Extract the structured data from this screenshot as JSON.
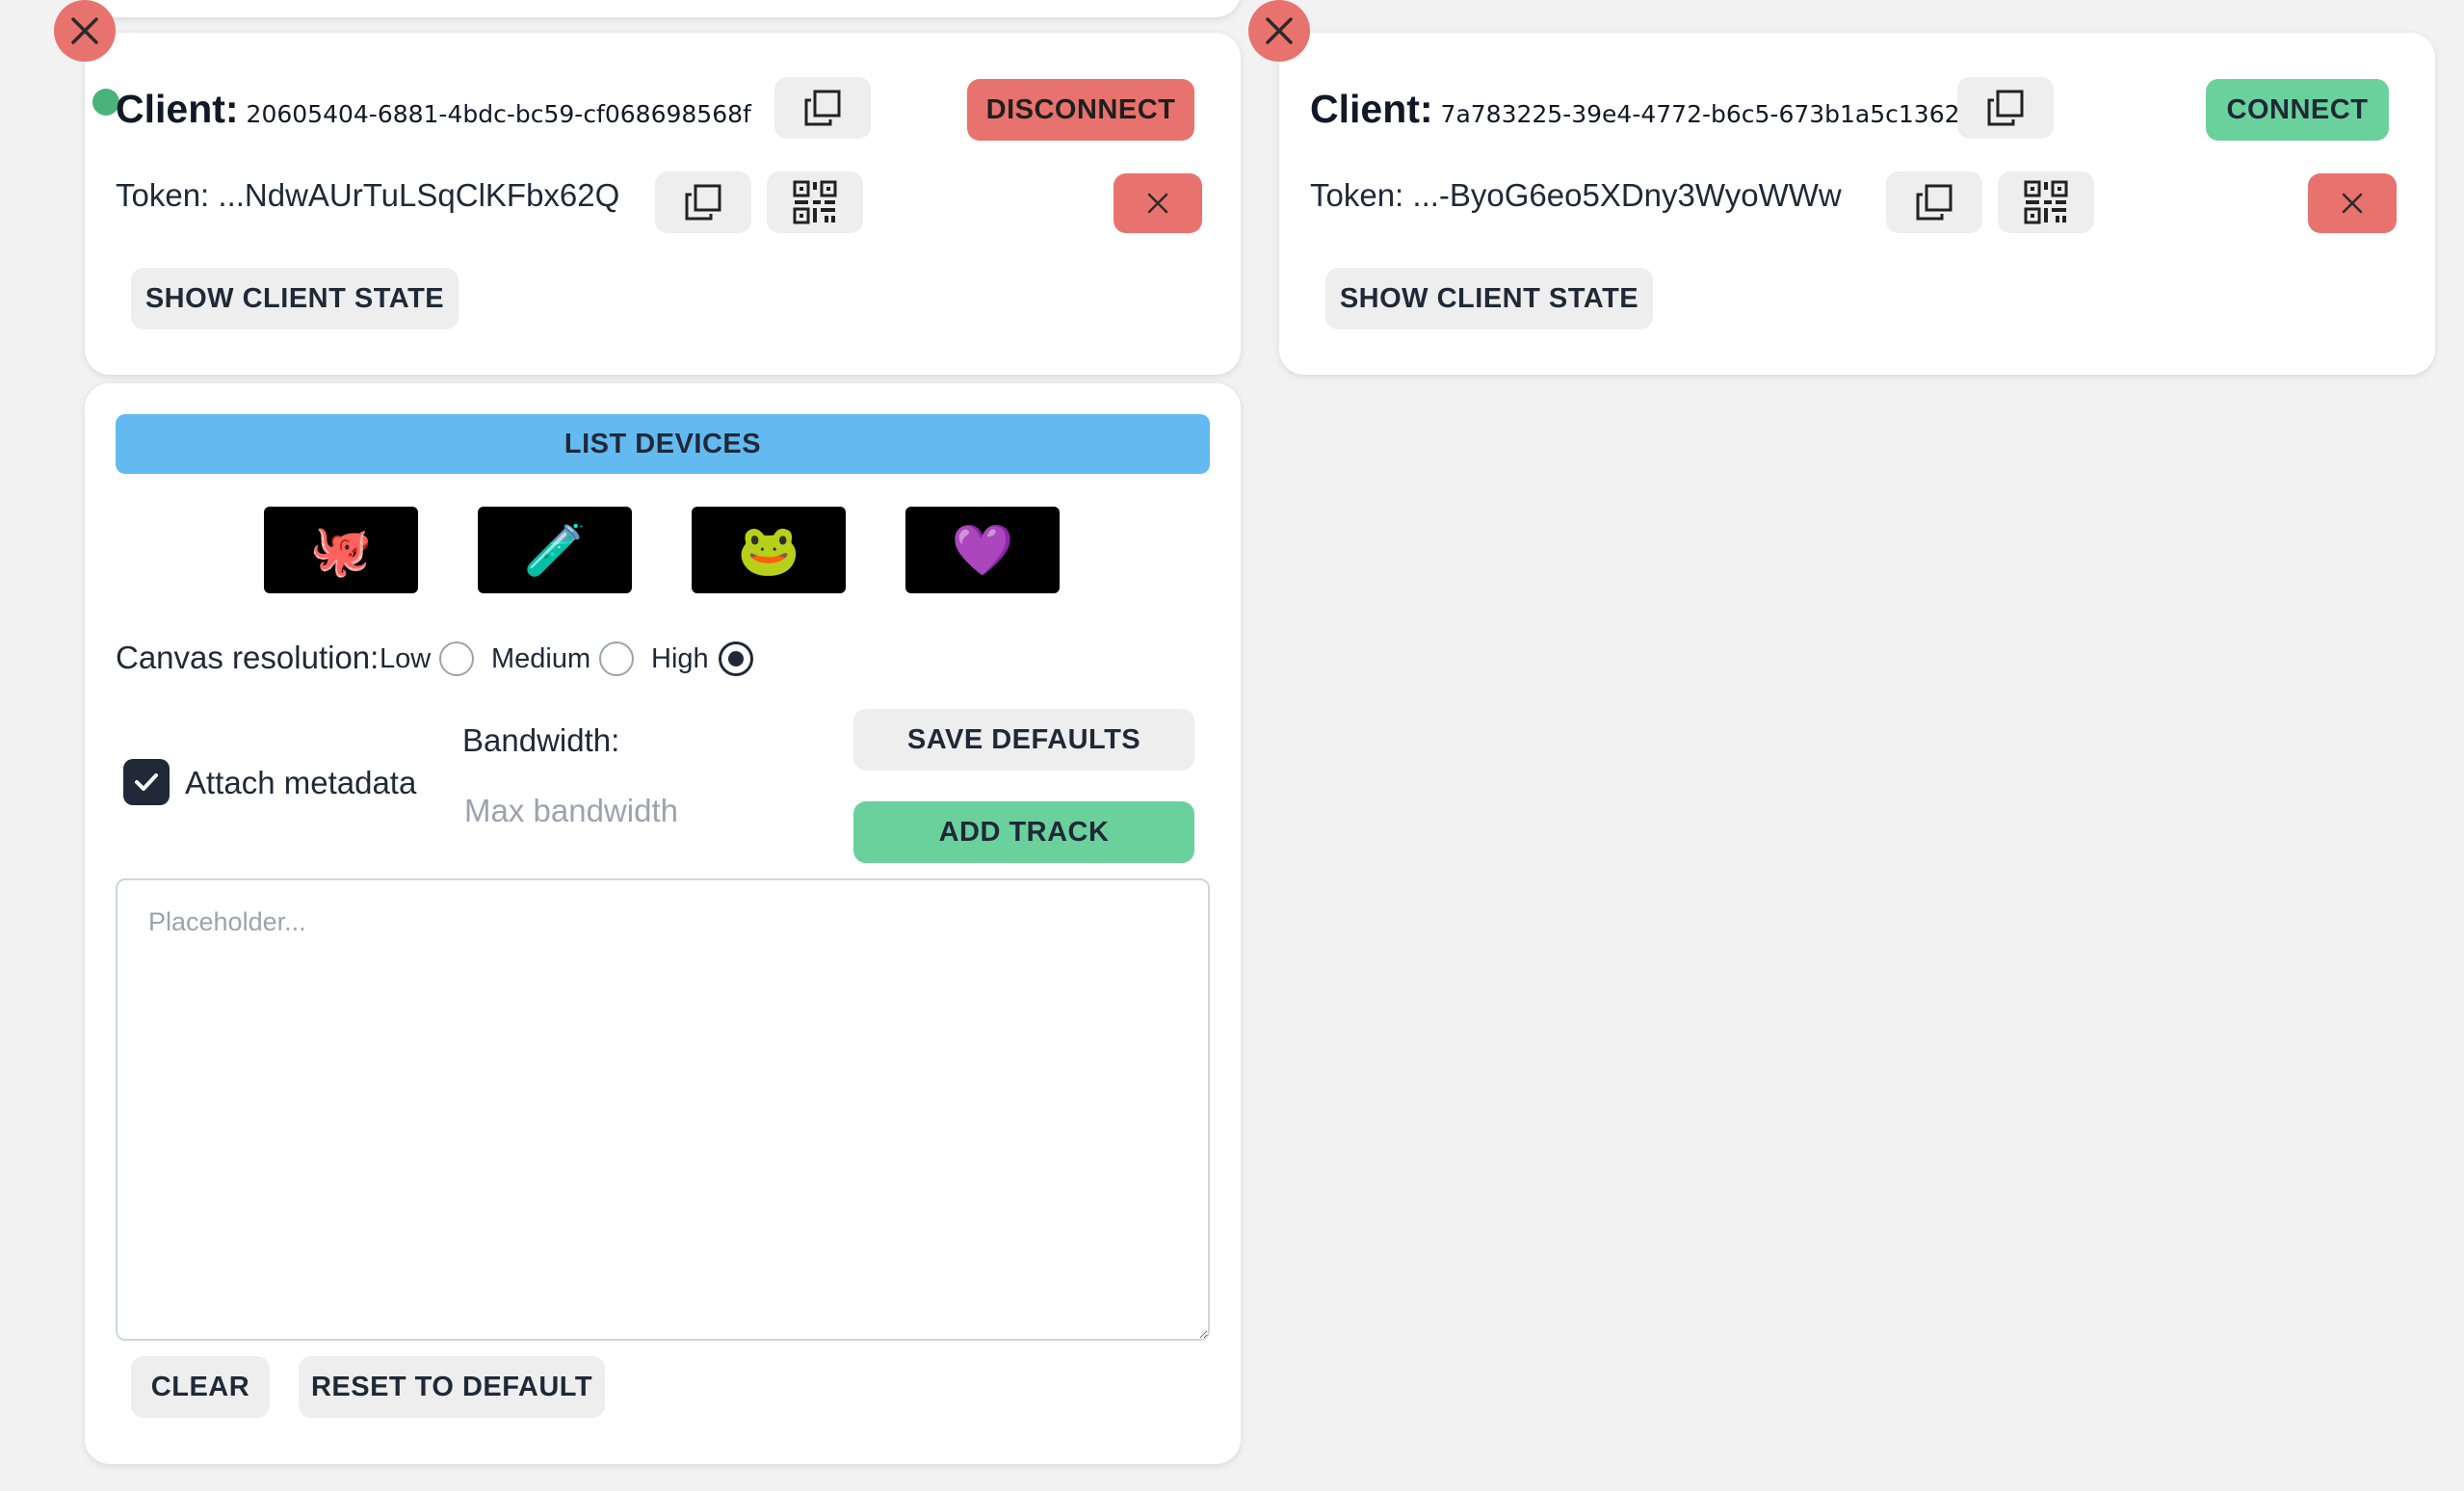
{
  "clients": [
    {
      "label": "Client:",
      "id": "20605404-6881-4bdc-bc59-cf068698568f",
      "connect_label": "DISCONNECT",
      "token": "Token: ...NdwAUrTuLSqClKFbx62Q",
      "show_state_label": "SHOW CLIENT STATE",
      "status": "connected"
    },
    {
      "label": "Client:",
      "id": "7a783225-39e4-4772-b6c5-673b1a5c1362",
      "connect_label": "CONNECT",
      "token": "Token: ...-ByoG6eo5XDny3WyoWWw",
      "show_state_label": "SHOW CLIENT STATE",
      "status": "disconnected"
    }
  ],
  "panel": {
    "list_devices_label": "LIST DEVICES",
    "emoji_tiles": [
      "🐙",
      "🧪",
      "🐸",
      "💜"
    ],
    "canvas_resolution_label": "Canvas resolution:",
    "resolution_options": [
      "Low",
      "Medium",
      "High"
    ],
    "selected_resolution": "High",
    "attach_metadata_label": "Attach metadata",
    "attach_metadata_checked": true,
    "bandwidth_label": "Bandwidth:",
    "bandwidth_placeholder": "Max bandwidth",
    "save_defaults_label": "SAVE DEFAULTS",
    "add_track_label": "ADD TRACK",
    "textarea_placeholder": "Placeholder...",
    "clear_label": "CLEAR",
    "reset_label": "RESET TO DEFAULT"
  },
  "colors": {
    "accent_red": "#e8736e",
    "accent_green": "#6bd19c",
    "accent_blue": "#63baf1",
    "status_online": "#4ab37a"
  }
}
